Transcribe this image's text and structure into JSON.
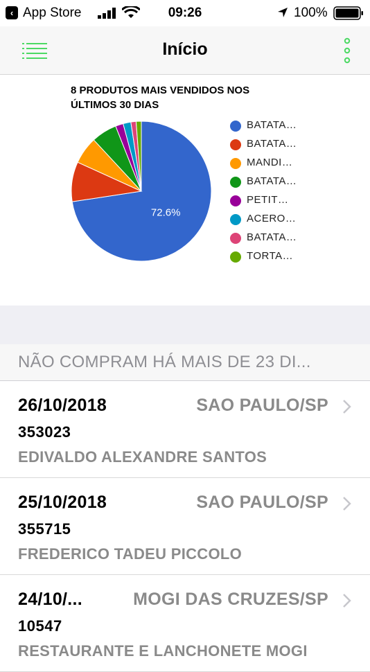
{
  "status_bar": {
    "back_app": "App Store",
    "time": "09:26",
    "battery": "100%"
  },
  "nav": {
    "title": "Início",
    "menu_icon": "list-icon",
    "more_icon": "vertical-dots-icon",
    "accent_color": "#4cd964"
  },
  "chart_data": {
    "type": "pie",
    "title_line1": "8 PRODUTOS MAIS VENDIDOS NOS",
    "title_line2": "ÚLTIMOS 30 DIAS",
    "legend_position": "right",
    "labels": [
      "BATATA…",
      "BATATA…",
      "MANDI…",
      "BATATA…",
      "PETIT…",
      "ACERO…",
      "BATATA…",
      "TORTA…"
    ],
    "values": [
      72.6,
      9.2,
      6.3,
      5.9,
      1.8,
      1.8,
      1.2,
      1.2
    ],
    "colors": [
      "#3366cc",
      "#dc3912",
      "#ff9900",
      "#109618",
      "#990099",
      "#0099c6",
      "#dd4477",
      "#66aa00"
    ],
    "slice_labels": [
      "72.6%",
      "",
      "",
      "",
      "",
      "",
      "",
      ""
    ]
  },
  "section": {
    "title": "NÃO COMPRAM HÁ MAIS DE 23 DI..."
  },
  "rows": [
    {
      "date": "26/10/2018",
      "city": "SAO PAULO/SP",
      "code": "353023",
      "name": "EDIVALDO ALEXANDRE SANTOS"
    },
    {
      "date": "25/10/2018",
      "city": "SAO PAULO/SP",
      "code": "355715",
      "name": "FREDERICO TADEU PICCOLO"
    },
    {
      "date": "24/10/...",
      "city": "MOGI DAS CRUZES/SP",
      "code": "10547",
      "name": "RESTAURANTE E LANCHONETE MOGI"
    }
  ]
}
